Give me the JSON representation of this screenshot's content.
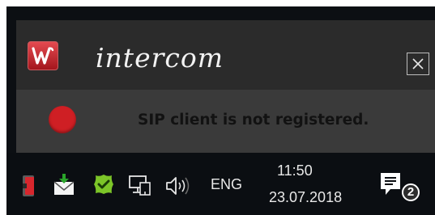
{
  "notification": {
    "app_name": "intercom",
    "close_glyph": "✕",
    "status_message": "SIP client is not registered.",
    "status_color": "#cf1f24",
    "logo_icon": "intercom-w-logo"
  },
  "taskbar": {
    "language": "ENG",
    "time": "11:50",
    "date": "23.07.2018",
    "notification_count": "2",
    "tray_icons": [
      "red-app-icon",
      "mail-download-icon",
      "green-app-icon",
      "network-icon",
      "volume-icon",
      "action-center-icon"
    ]
  }
}
